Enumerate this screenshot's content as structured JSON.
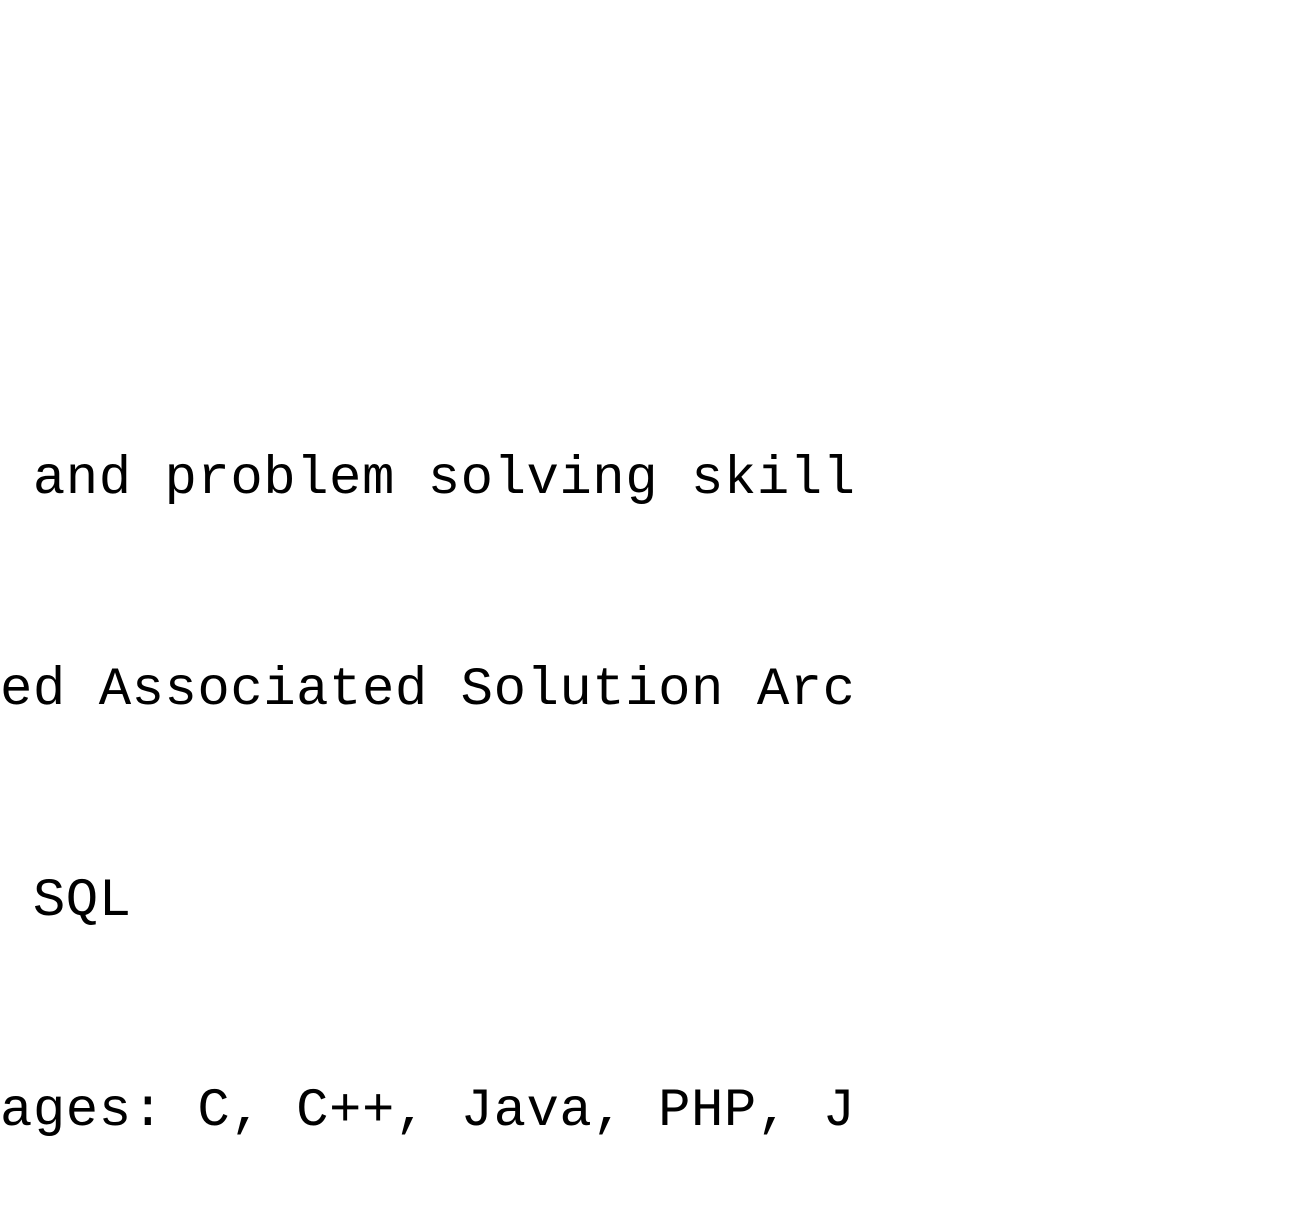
{
  "document": {
    "lines": [
      " and problem solving skill",
      "ed Associated Solution Arc",
      " SQL",
      "ages: C, C++, Java, PHP, J"
    ]
  }
}
